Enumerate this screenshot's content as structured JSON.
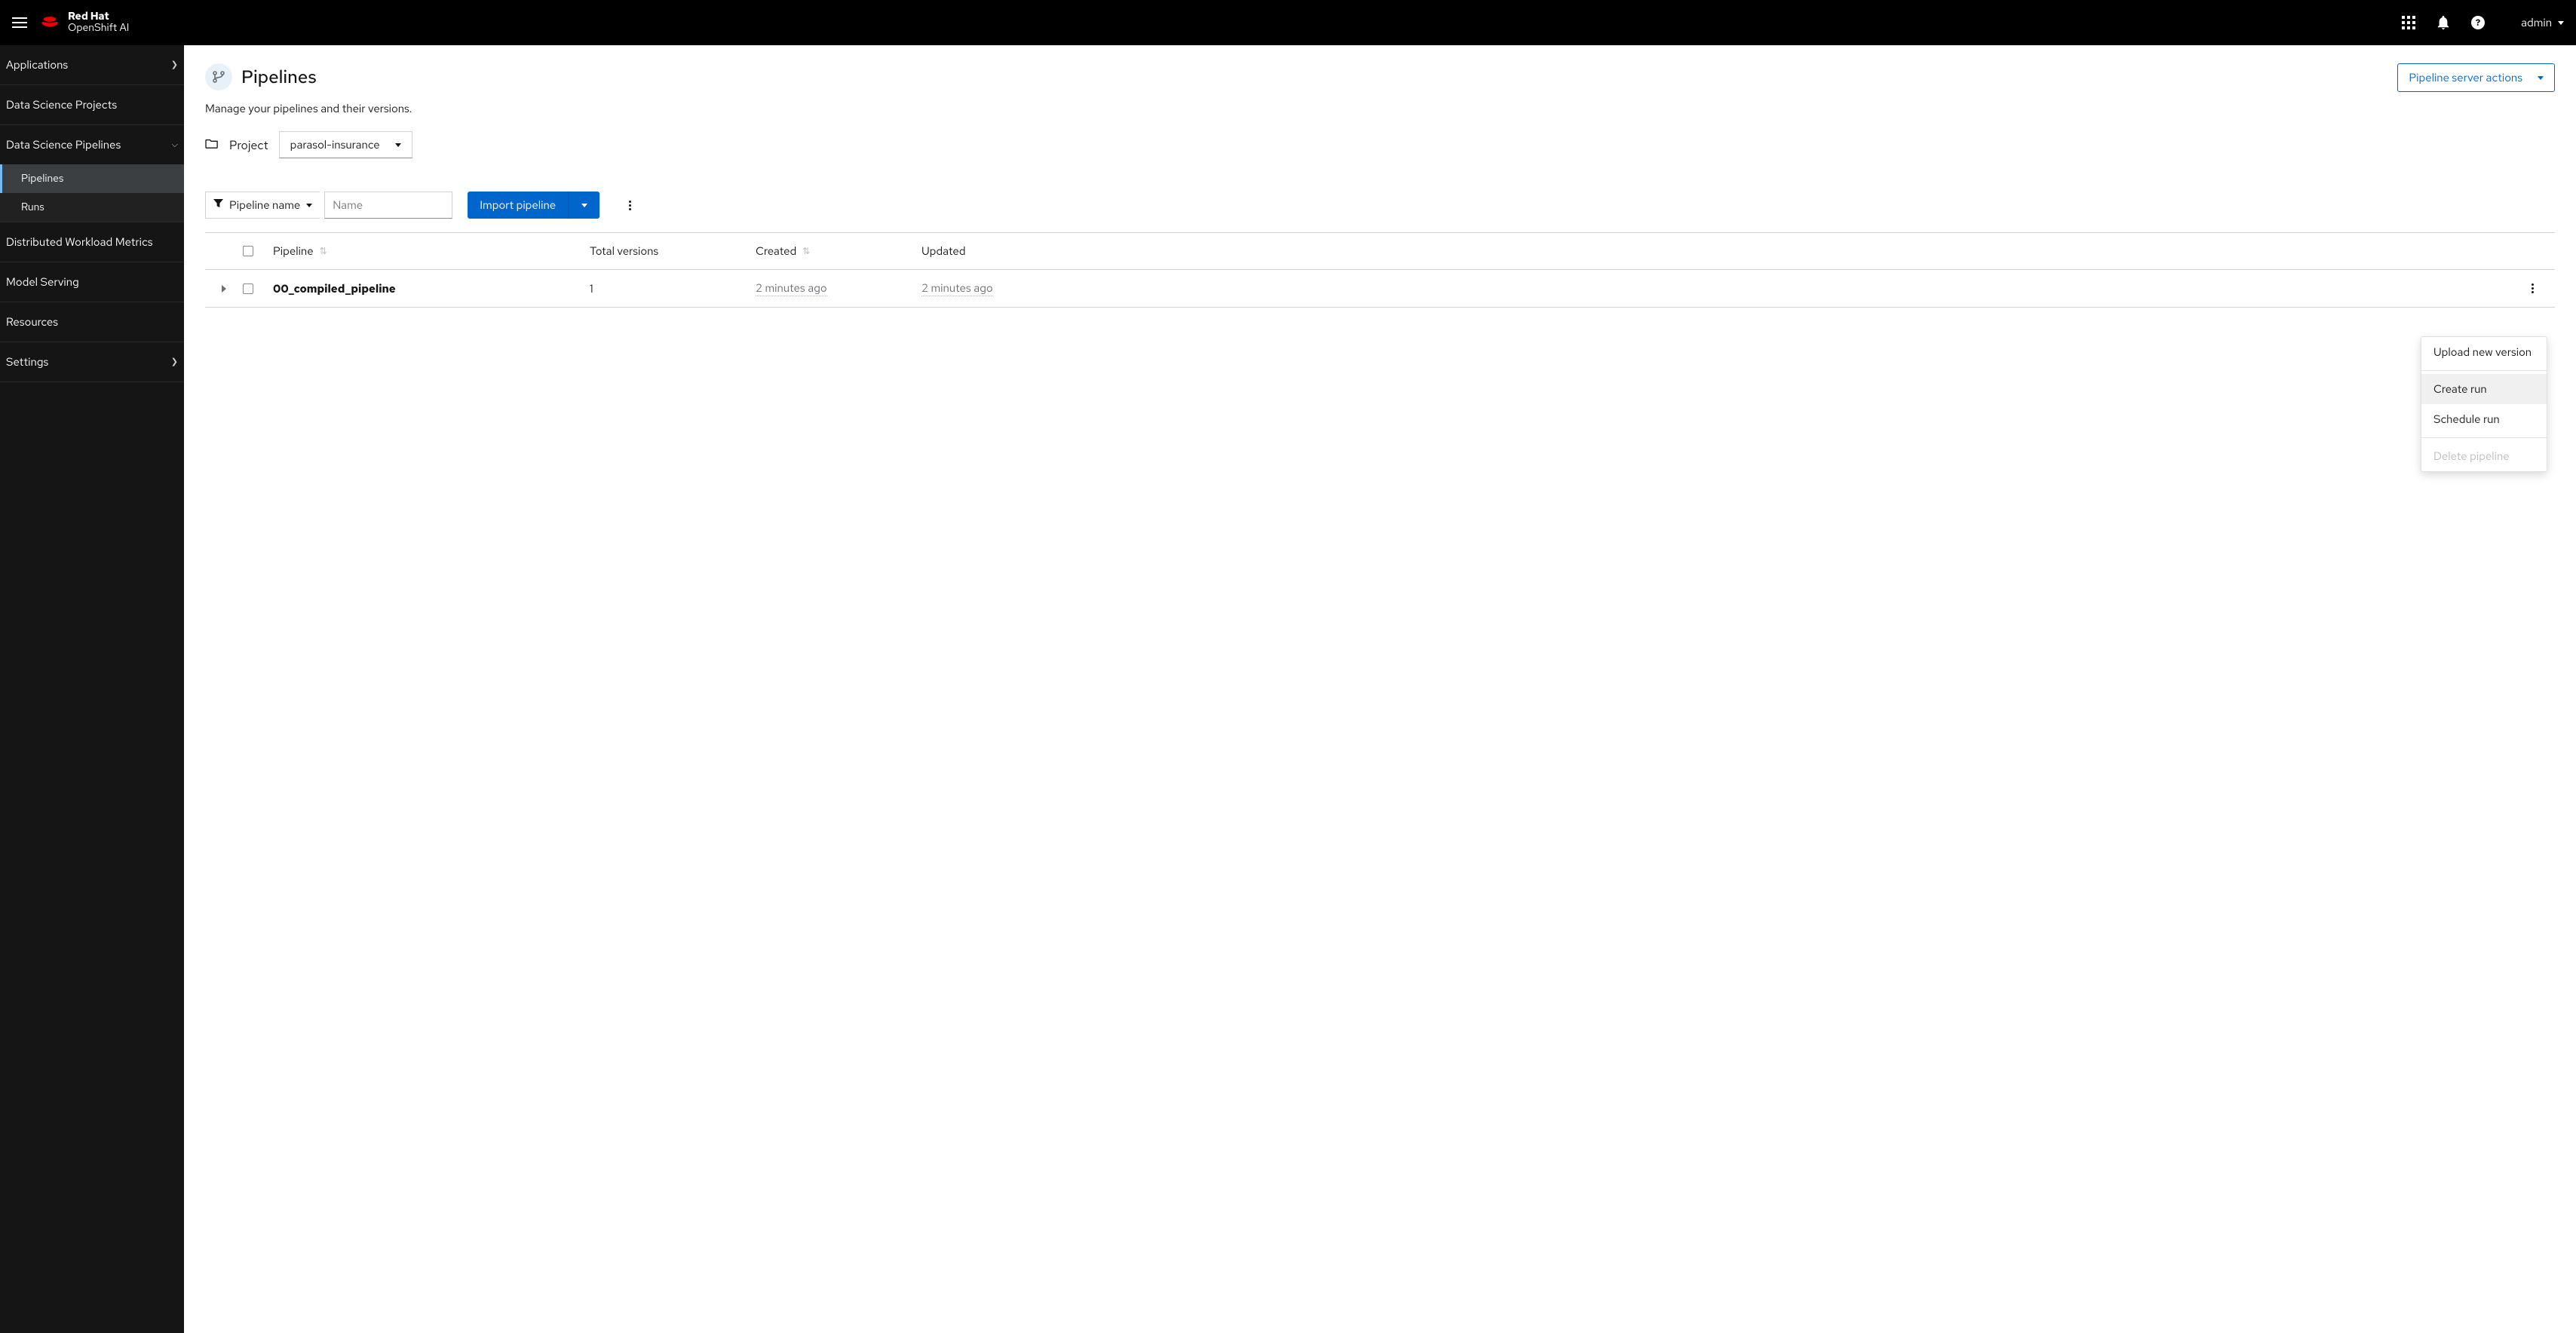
{
  "brand": {
    "top": "Red Hat",
    "bottom": "OpenShift AI"
  },
  "user": {
    "name": "admin"
  },
  "sidebar": {
    "applications": "Applications",
    "ds_projects": "Data Science Projects",
    "ds_pipelines": "Data Science Pipelines",
    "pipelines": "Pipelines",
    "runs": "Runs",
    "dwm": "Distributed Workload Metrics",
    "model_serving": "Model Serving",
    "resources": "Resources",
    "settings": "Settings"
  },
  "page": {
    "title": "Pipelines",
    "description": "Manage your pipelines and their versions.",
    "server_actions": "Pipeline server actions"
  },
  "project": {
    "label": "Project",
    "selected": "parasol-insurance"
  },
  "toolbar": {
    "filter_label": "Pipeline name",
    "name_placeholder": "Name",
    "import_label": "Import pipeline"
  },
  "table": {
    "headers": {
      "pipeline": "Pipeline",
      "total_versions": "Total versions",
      "created": "Created",
      "updated": "Updated"
    },
    "rows": [
      {
        "name": "00_compiled_pipeline",
        "total_versions": "1",
        "created": "2 minutes ago",
        "updated": "2 minutes ago"
      }
    ]
  },
  "dropdown": {
    "upload": "Upload new version",
    "create_run": "Create run",
    "schedule_run": "Schedule run",
    "delete": "Delete pipeline"
  }
}
